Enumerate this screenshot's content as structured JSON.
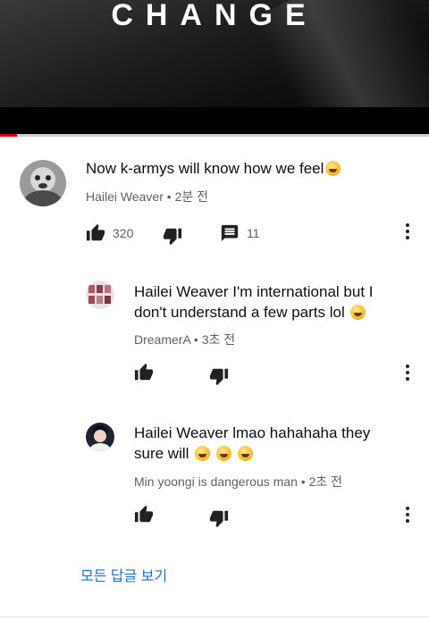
{
  "video": {
    "title": "CHANGE",
    "progress_percent": 4,
    "buffered_percent": 48,
    "accent_color": "#e00000"
  },
  "comments": [
    {
      "text": "Now k-armys will know how we feel",
      "emoji": [
        "grinning-squint-face"
      ],
      "author": "Hailei Weaver",
      "separator": "•",
      "time": "2분 전",
      "likes": "320",
      "replies": "11",
      "icons": [
        "thumbs-up-icon",
        "thumbs-down-icon",
        "comment-icon",
        "more-vert-icon"
      ]
    },
    {
      "text_line1": "Hailei Weaver I'm international but I",
      "text_line2": "don't understand a few parts lol",
      "emoji": [
        "slightly-smiling-face"
      ],
      "author": "DreamerA",
      "separator": "•",
      "time": "3초 전",
      "icons": [
        "thumbs-up-icon",
        "thumbs-down-icon",
        "more-vert-icon"
      ]
    },
    {
      "text_line1": "Hailei Weaver lmao hahahaha they",
      "text_line2": "sure will",
      "emoji": [
        "grinning-squint-face",
        "grinning-squint-face",
        "grinning-squint-face"
      ],
      "author": "Min yoongi is dangerous man",
      "separator": "•",
      "time": "2초 전",
      "icons": [
        "thumbs-up-icon",
        "thumbs-down-icon",
        "more-vert-icon"
      ]
    }
  ],
  "view_all_replies": "모든 답글 보기",
  "colors": {
    "link": "#1a6fd6",
    "meta": "#606060",
    "text": "#0f0f0f"
  }
}
